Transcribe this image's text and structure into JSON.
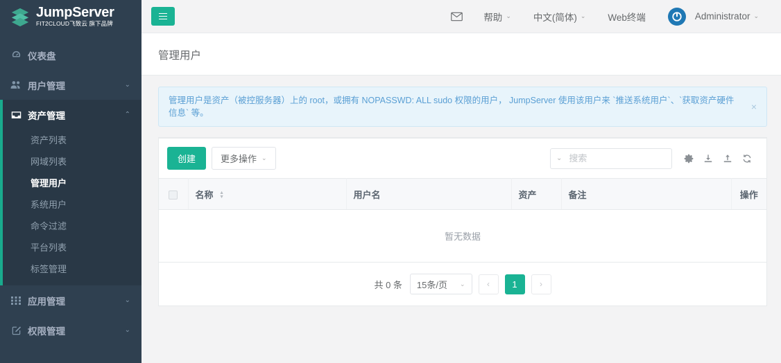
{
  "brand": {
    "name": "JumpServer",
    "tagline": "FIT2CLOUD飞致云 旗下品牌",
    "logo_icon": "jumpserver-stack-logo",
    "accent_color": "#1ab394",
    "sidebar_color": "#2f4050"
  },
  "sidebar": {
    "items": [
      {
        "label": "仪表盘",
        "icon": "dashboard-icon",
        "has_children": false,
        "active": false
      },
      {
        "label": "用户管理",
        "icon": "users-icon",
        "has_children": true,
        "expanded": false,
        "active": false
      },
      {
        "label": "资产管理",
        "icon": "inbox-icon",
        "has_children": true,
        "expanded": true,
        "active": true
      },
      {
        "label": "应用管理",
        "icon": "grid-apps-icon",
        "has_children": true,
        "expanded": false,
        "active": false
      },
      {
        "label": "权限管理",
        "icon": "edit-square-icon",
        "has_children": true,
        "expanded": false,
        "active": false
      }
    ],
    "asset_submenu": [
      {
        "label": "资产列表",
        "current": false
      },
      {
        "label": "网域列表",
        "current": false
      },
      {
        "label": "管理用户",
        "current": true
      },
      {
        "label": "系统用户",
        "current": false
      },
      {
        "label": "命令过滤",
        "current": false
      },
      {
        "label": "平台列表",
        "current": false
      },
      {
        "label": "标签管理",
        "current": false
      }
    ]
  },
  "topbar": {
    "menu_toggle_icon": "hamburger-icon",
    "mail_icon": "envelope-icon",
    "help_label": "帮助",
    "language_label": "中文(简体)",
    "web_terminal_label": "Web终端",
    "avatar_icon": "power-user-avatar-icon",
    "username": "Administrator",
    "caret_icon": "chevron-down-icon",
    "avatar_color": "#1f78b4"
  },
  "page": {
    "title": "管理用户"
  },
  "alert": {
    "message": "管理用户是资产（被控服务器）上的 root，或拥有 NOPASSWD: ALL sudo 权限的用户， JumpServer 使用该用户来 `推送系统用户`、`获取资产硬件信息` 等。",
    "close_icon": "close-icon"
  },
  "toolbar": {
    "create_label": "创建",
    "more_actions_label": "更多操作",
    "more_caret_icon": "chevron-down-icon",
    "search_placeholder": "搜索",
    "search_value": "",
    "search_caret_icon": "chevron-down-icon",
    "icons": [
      {
        "name": "gear-icon",
        "title": "设置"
      },
      {
        "name": "download-icon",
        "title": "导入"
      },
      {
        "name": "upload-icon",
        "title": "导出"
      },
      {
        "name": "refresh-icon",
        "title": "刷新"
      }
    ]
  },
  "table": {
    "select_all_checkbox": "",
    "columns": [
      {
        "key": "name",
        "label": "名称",
        "sortable": true
      },
      {
        "key": "username",
        "label": "用户名",
        "sortable": false
      },
      {
        "key": "asset",
        "label": "资产",
        "sortable": false
      },
      {
        "key": "note",
        "label": "备注",
        "sortable": false
      },
      {
        "key": "action",
        "label": "操作",
        "sortable": false
      }
    ],
    "rows": [],
    "empty_text": "暂无数据"
  },
  "pagination": {
    "total_text": "共 0 条",
    "page_size_label": "15条/页",
    "page_size_caret_icon": "chevron-down-icon",
    "prev_icon": "chevron-left-icon",
    "next_icon": "chevron-right-icon",
    "current_page": "1"
  }
}
